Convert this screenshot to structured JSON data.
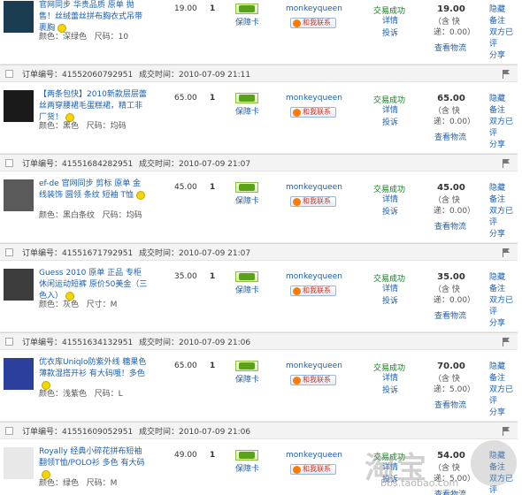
{
  "labels": {
    "order_no": "订单编号：",
    "deal_time": "成交时间：",
    "baozhang": "保障卡",
    "wangwang": "和我联系",
    "status": "交易成功",
    "detail": "详情",
    "complaint": "投诉",
    "incl_shipping": "（含 快",
    "view_logistics": "查看物流",
    "hide": "隐藏",
    "note": "备注",
    "both_rated": "双方已评",
    "share": "分享",
    "color": "颜色：",
    "size": "尺码："
  },
  "orders": [
    {
      "order_no": "",
      "deal_time": "",
      "title": "官网同步 华贵品质 原单 抛售！丝绒蕾丝拼布胸衣式吊带裹胸",
      "color": "深绿色",
      "size_label": "尺码：",
      "size": "10",
      "price": "19.00",
      "qty": "1",
      "seller": "monkeyqueen",
      "total": "19.00",
      "incl": "（含 快",
      "shipping": "递：0.00）",
      "thumb_color": "#1a3d52"
    },
    {
      "order_no": "41552060792951",
      "deal_time": "2010-07-09 21:11",
      "title": "【两条包快】2010新款层层蕾丝两穿腰裙毛蛋糕裙，精工非厂货！",
      "color": "黑色",
      "size_label": "尺码：",
      "size": "均码",
      "price": "65.00",
      "qty": "1",
      "seller": "monkeyqueen",
      "total": "65.00",
      "incl": "（含 快",
      "shipping": "递：0.00）",
      "thumb_color": "#1a1a1a"
    },
    {
      "order_no": "41551684282951",
      "deal_time": "2010-07-09 21:07",
      "title": "ef-de 官网同步 剪标 原单 金线装饰 圆领 条纹 短袖 T恤",
      "color": "黑白条纹",
      "size_label": "尺码：",
      "size": "均码",
      "price": "45.00",
      "qty": "1",
      "seller": "monkeyqueen",
      "total": "45.00",
      "incl": "（含 快",
      "shipping": "递：0.00）",
      "thumb_color": "#5a5a5a"
    },
    {
      "order_no": "41551671792951",
      "deal_time": "2010-07-09 21:07",
      "title": "Guess 2010 原单 正品 专柜休闲运动短裤 原价50美金（三色入）",
      "color": "灰色",
      "size_label": "尺寸：",
      "size": "M",
      "price": "35.00",
      "qty": "1",
      "seller": "monkeyqueen",
      "total": "35.00",
      "incl": "（含 快",
      "shipping": "递：0.00）",
      "thumb_color": "#3c3c3c"
    },
    {
      "order_no": "41551634132951",
      "deal_time": "2010-07-09 21:06",
      "title": "优衣库Uniqlo防紫外线 糖果色薄款湿搭开衫 有大码哦！多色",
      "color": "浅紫色",
      "size_label": "尺码：",
      "size": "L",
      "price": "65.00",
      "qty": "1",
      "seller": "monkeyqueen",
      "total": "70.00",
      "incl": "（含 快",
      "shipping": "递：5.00）",
      "thumb_color": "#2b3f9c"
    },
    {
      "order_no": "41551609052951",
      "deal_time": "2010-07-09 21:06",
      "title": "Royally 经典小碎花拼布短袖翻领T恤/POLO衫 多色 有大码",
      "color": "绿色",
      "size_label": "尺码：",
      "size": "M",
      "price": "49.00",
      "qty": "1",
      "seller": "monkeyqueen",
      "total": "54.00",
      "incl": "（含 快",
      "shipping": "递：5.00）",
      "thumb_color": "#e8e8e8"
    }
  ],
  "watermark": {
    "brand": "淘宝",
    "url": "bbs.taobao.com"
  }
}
